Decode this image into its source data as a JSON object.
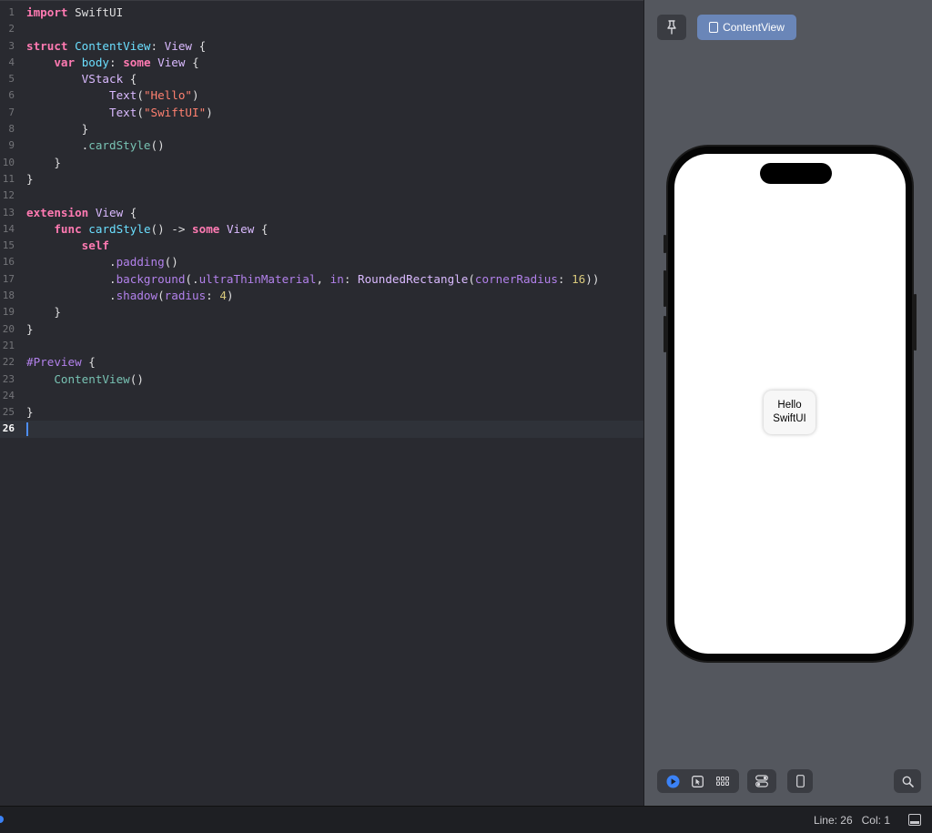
{
  "editor": {
    "current_line": 26,
    "lines": [
      {
        "n": "1",
        "tokens": [
          {
            "c": "kw",
            "t": "import"
          },
          {
            "c": "plain",
            "t": " SwiftUI"
          }
        ]
      },
      {
        "n": "2",
        "tokens": []
      },
      {
        "n": "3",
        "tokens": [
          {
            "c": "kw",
            "t": "struct"
          },
          {
            "c": "plain",
            "t": " "
          },
          {
            "c": "decl",
            "t": "ContentView"
          },
          {
            "c": "plain",
            "t": ": "
          },
          {
            "c": "type",
            "t": "View"
          },
          {
            "c": "plain",
            "t": " {"
          }
        ]
      },
      {
        "n": "4",
        "tokens": [
          {
            "c": "plain",
            "t": "    "
          },
          {
            "c": "kw",
            "t": "var"
          },
          {
            "c": "plain",
            "t": " "
          },
          {
            "c": "decl",
            "t": "body"
          },
          {
            "c": "plain",
            "t": ": "
          },
          {
            "c": "kw",
            "t": "some"
          },
          {
            "c": "plain",
            "t": " "
          },
          {
            "c": "type",
            "t": "View"
          },
          {
            "c": "plain",
            "t": " {"
          }
        ]
      },
      {
        "n": "5",
        "tokens": [
          {
            "c": "plain",
            "t": "        "
          },
          {
            "c": "type",
            "t": "VStack"
          },
          {
            "c": "plain",
            "t": " {"
          }
        ]
      },
      {
        "n": "6",
        "tokens": [
          {
            "c": "plain",
            "t": "            "
          },
          {
            "c": "type",
            "t": "Text"
          },
          {
            "c": "plain",
            "t": "("
          },
          {
            "c": "str",
            "t": "\"Hello\""
          },
          {
            "c": "plain",
            "t": ")"
          }
        ]
      },
      {
        "n": "7",
        "tokens": [
          {
            "c": "plain",
            "t": "            "
          },
          {
            "c": "type",
            "t": "Text"
          },
          {
            "c": "plain",
            "t": "("
          },
          {
            "c": "str",
            "t": "\"SwiftUI\""
          },
          {
            "c": "plain",
            "t": ")"
          }
        ]
      },
      {
        "n": "8",
        "tokens": [
          {
            "c": "plain",
            "t": "        }"
          }
        ]
      },
      {
        "n": "9",
        "tokens": [
          {
            "c": "plain",
            "t": "        ."
          },
          {
            "c": "ident",
            "t": "cardStyle"
          },
          {
            "c": "plain",
            "t": "()"
          }
        ]
      },
      {
        "n": "10",
        "tokens": [
          {
            "c": "plain",
            "t": "    }"
          }
        ]
      },
      {
        "n": "11",
        "tokens": [
          {
            "c": "plain",
            "t": "}"
          }
        ]
      },
      {
        "n": "12",
        "tokens": []
      },
      {
        "n": "13",
        "tokens": [
          {
            "c": "kw",
            "t": "extension"
          },
          {
            "c": "plain",
            "t": " "
          },
          {
            "c": "type",
            "t": "View"
          },
          {
            "c": "plain",
            "t": " {"
          }
        ]
      },
      {
        "n": "14",
        "tokens": [
          {
            "c": "plain",
            "t": "    "
          },
          {
            "c": "kw",
            "t": "func"
          },
          {
            "c": "plain",
            "t": " "
          },
          {
            "c": "decl",
            "t": "cardStyle"
          },
          {
            "c": "plain",
            "t": "() -> "
          },
          {
            "c": "kw",
            "t": "some"
          },
          {
            "c": "plain",
            "t": " "
          },
          {
            "c": "type",
            "t": "View"
          },
          {
            "c": "plain",
            "t": " {"
          }
        ]
      },
      {
        "n": "15",
        "tokens": [
          {
            "c": "plain",
            "t": "        "
          },
          {
            "c": "kw",
            "t": "self"
          }
        ]
      },
      {
        "n": "16",
        "tokens": [
          {
            "c": "plain",
            "t": "            ."
          },
          {
            "c": "method",
            "t": "padding"
          },
          {
            "c": "plain",
            "t": "()"
          }
        ]
      },
      {
        "n": "17",
        "tokens": [
          {
            "c": "plain",
            "t": "            ."
          },
          {
            "c": "method",
            "t": "background"
          },
          {
            "c": "plain",
            "t": "(."
          },
          {
            "c": "method",
            "t": "ultraThinMaterial"
          },
          {
            "c": "plain",
            "t": ", "
          },
          {
            "c": "method",
            "t": "in"
          },
          {
            "c": "plain",
            "t": ": "
          },
          {
            "c": "type",
            "t": "RoundedRectangle"
          },
          {
            "c": "plain",
            "t": "("
          },
          {
            "c": "method",
            "t": "cornerRadius"
          },
          {
            "c": "plain",
            "t": ": "
          },
          {
            "c": "num",
            "t": "16"
          },
          {
            "c": "plain",
            "t": "))"
          }
        ]
      },
      {
        "n": "18",
        "tokens": [
          {
            "c": "plain",
            "t": "            ."
          },
          {
            "c": "method",
            "t": "shadow"
          },
          {
            "c": "plain",
            "t": "("
          },
          {
            "c": "method",
            "t": "radius"
          },
          {
            "c": "plain",
            "t": ": "
          },
          {
            "c": "num",
            "t": "4"
          },
          {
            "c": "plain",
            "t": ")"
          }
        ]
      },
      {
        "n": "19",
        "tokens": [
          {
            "c": "plain",
            "t": "    }"
          }
        ]
      },
      {
        "n": "20",
        "tokens": [
          {
            "c": "plain",
            "t": "}"
          }
        ]
      },
      {
        "n": "21",
        "tokens": []
      },
      {
        "n": "22",
        "tokens": [
          {
            "c": "macro",
            "t": "#Preview"
          },
          {
            "c": "plain",
            "t": " {"
          }
        ]
      },
      {
        "n": "23",
        "tokens": [
          {
            "c": "plain",
            "t": "    "
          },
          {
            "c": "ident",
            "t": "ContentView"
          },
          {
            "c": "plain",
            "t": "()"
          }
        ]
      },
      {
        "n": "24",
        "tokens": []
      },
      {
        "n": "25",
        "tokens": [
          {
            "c": "plain",
            "t": "}"
          }
        ]
      },
      {
        "n": "26",
        "tokens": []
      }
    ]
  },
  "preview": {
    "pin_icon": "pin-icon",
    "tab_label": "ContentView",
    "tab_icon": "document-icon",
    "card": {
      "line1": "Hello",
      "line2": "SwiftUI"
    },
    "toolbar": {
      "live_icon": "play-icon",
      "select_icon": "selectable-cursor-icon",
      "variants_icon": "grid-variants-icon",
      "settings_icon": "canvas-settings-icon",
      "device_icon": "device-icon",
      "zoom_icon": "magnifier-icon"
    },
    "accent_color": "#3b82f6"
  },
  "status": {
    "line_label": "Line: 26",
    "col_label": "Col: 1",
    "panel_icon": "bottom-panel-toggle-icon"
  }
}
